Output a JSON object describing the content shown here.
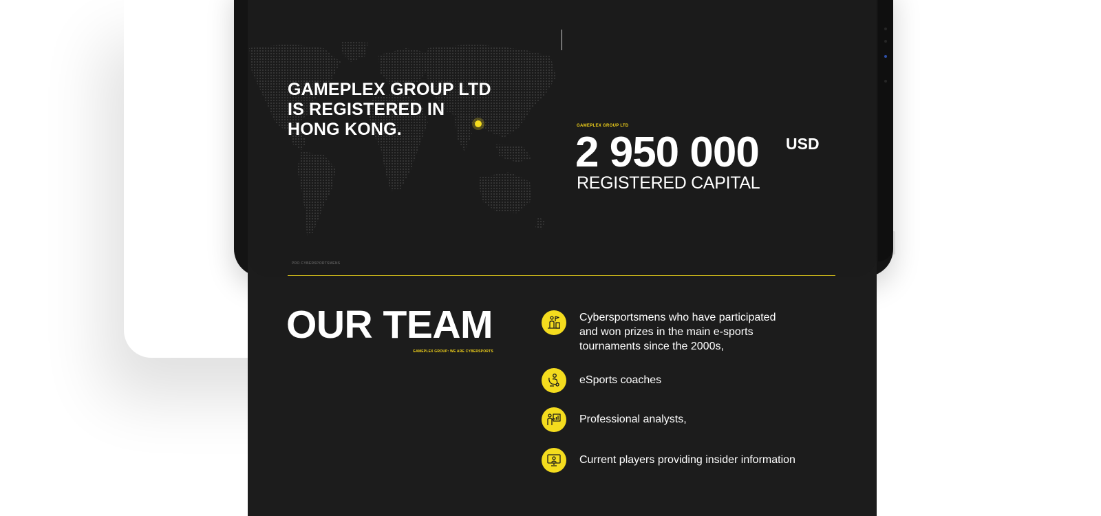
{
  "hero": {
    "registered_text": "GAMEPLEX GROUP LTD\nIS REGISTERED IN\nHONG KONG.",
    "capital_label": "GAMEPLEX GROUP LTD",
    "capital_value": "2 950 000",
    "capital_unit": "USD",
    "capital_caption": "REGISTERED CAPITAL"
  },
  "team": {
    "section_tag": "PRO CYBERSPORTSMENS",
    "title": "OUR TEAM",
    "subtitle": "GAMEPLEX GROUP: WE ARE CYBERSPORTS",
    "items": [
      {
        "icon": "trophy-podium-icon",
        "text": "Cybersportsmens who have participated\nand won prizes in the main e-sports\ntournaments since the 2000s,"
      },
      {
        "icon": "coach-whistle-icon",
        "text": "eSports coaches"
      },
      {
        "icon": "analyst-chart-icon",
        "text": "Professional analysts,"
      },
      {
        "icon": "player-monitor-icon",
        "text": "Current players providing insider information"
      }
    ]
  },
  "colors": {
    "accent": "#f4dc1e",
    "background": "#1c1c1c",
    "text": "#ffffff"
  }
}
